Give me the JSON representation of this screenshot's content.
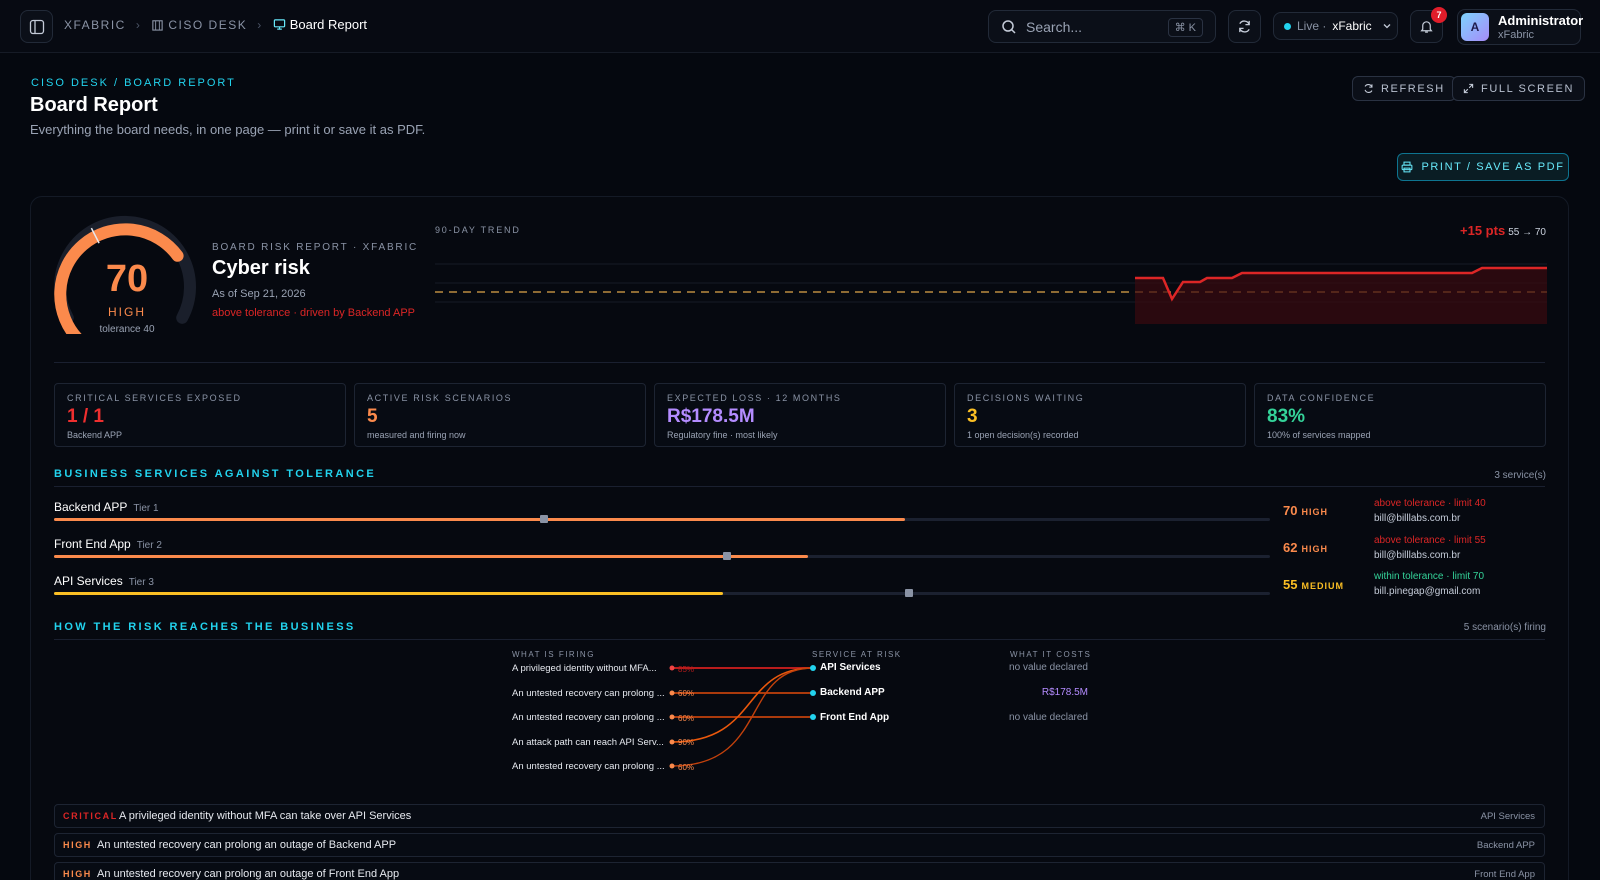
{
  "topbar": {
    "crumb_org": "XFABRIC",
    "crumb_desk": "CISO DESK",
    "crumb_page": "Board Report",
    "search_placeholder": "Search...",
    "search_shortcut": "⌘ K",
    "live_label": "Live ·",
    "live_tenant": "xFabric",
    "notification_count": "7",
    "user_initial": "A",
    "user_name": "Administrator",
    "user_org": "xFabric"
  },
  "header": {
    "kicker": "CISO DESK / BOARD REPORT",
    "title": "Board Report",
    "subtitle": "Everything the board needs, in one page — print it or save it as PDF.",
    "refresh_label": "REFRESH",
    "fullscreen_label": "FULL SCREEN",
    "print_label": "PRINT / SAVE AS PDF"
  },
  "risk": {
    "score": "70",
    "score_value": 70,
    "level": "HIGH",
    "tolerance": "tolerance 40",
    "report_kicker": "BOARD RISK REPORT · XFABRIC",
    "title": "Cyber risk",
    "as_of": "As of Sep 21, 2026",
    "alert": "above tolerance · driven by Backend APP"
  },
  "trend": {
    "label": "90-DAY TREND",
    "delta": "+15 pts",
    "range": "55 → 70"
  },
  "kpis": [
    {
      "label": "CRITICAL SERVICES EXPOSED",
      "value": "1 / 1",
      "sub": "Backend APP",
      "color": "#ef2f2f"
    },
    {
      "label": "ACTIVE RISK SCENARIOS",
      "value": "5",
      "sub": "measured and firing now",
      "color": "#fb8a4c"
    },
    {
      "label": "EXPECTED LOSS · 12 MONTHS",
      "value": "R$178.5M",
      "sub": "Regulatory fine · most likely",
      "color": "#b48cff"
    },
    {
      "label": "DECISIONS WAITING",
      "value": "3",
      "sub": "1 open decision(s) recorded",
      "color": "#fbbf24"
    },
    {
      "label": "DATA CONFIDENCE",
      "value": "83%",
      "sub": "100% of services mapped",
      "color": "#34d399"
    }
  ],
  "services_section": {
    "title": "BUSINESS SERVICES AGAINST TOLERANCE",
    "count": "3 service(s)"
  },
  "services": [
    {
      "name": "Backend APP",
      "tier": "Tier 1",
      "score": "70",
      "level": "HIGH",
      "tolerance": "above tolerance · limit 40",
      "owner": "bill@billlabs.com.br",
      "color": "#fb8a4c",
      "tol_color": "#dc2626"
    },
    {
      "name": "Front End App",
      "tier": "Tier 2",
      "score": "62",
      "level": "HIGH",
      "tolerance": "above tolerance · limit 55",
      "owner": "bill@billlabs.com.br",
      "color": "#fb8a4c",
      "tol_color": "#dc2626"
    },
    {
      "name": "API Services",
      "tier": "Tier 3",
      "score": "55",
      "level": "MEDIUM",
      "tolerance": "within tolerance · limit 70",
      "owner": "bill.pinegap@gmail.com",
      "color": "#fbbf24",
      "tol_color": "#34d399"
    }
  ],
  "flow_section": {
    "title": "HOW THE RISK REACHES THE BUSINESS",
    "count": "5 scenario(s) firing"
  },
  "flow": {
    "col_firing": "WHAT IS FIRING",
    "col_service": "SERVICE AT RISK",
    "col_cost": "WHAT IT COSTS",
    "scenarios": [
      {
        "label": "A privileged identity without MFA...",
        "pct": "85%"
      },
      {
        "label": "An untested recovery can prolong ...",
        "pct": "60%"
      },
      {
        "label": "An untested recovery can prolong ...",
        "pct": "60%"
      },
      {
        "label": "An attack path can reach API Serv...",
        "pct": "90%"
      },
      {
        "label": "An untested recovery can prolong ...",
        "pct": "60%"
      }
    ],
    "services": [
      {
        "name": "API Services",
        "cost": "no value declared"
      },
      {
        "name": "Backend APP",
        "cost": "R$178.5M"
      },
      {
        "name": "Front End App",
        "cost": "no value declared"
      }
    ]
  },
  "scenario_rows": [
    {
      "severity": "CRITICAL",
      "title": "A privileged identity without MFA can take over API Services",
      "service": "API Services",
      "color": "#dc2626"
    },
    {
      "severity": "HIGH",
      "title": "An untested recovery can prolong an outage of Backend APP",
      "service": "Backend APP",
      "color": "#fb8a4c"
    },
    {
      "severity": "HIGH",
      "title": "An untested recovery can prolong an outage of Front End App",
      "service": "Front End App",
      "color": "#fb8a4c"
    }
  ]
}
